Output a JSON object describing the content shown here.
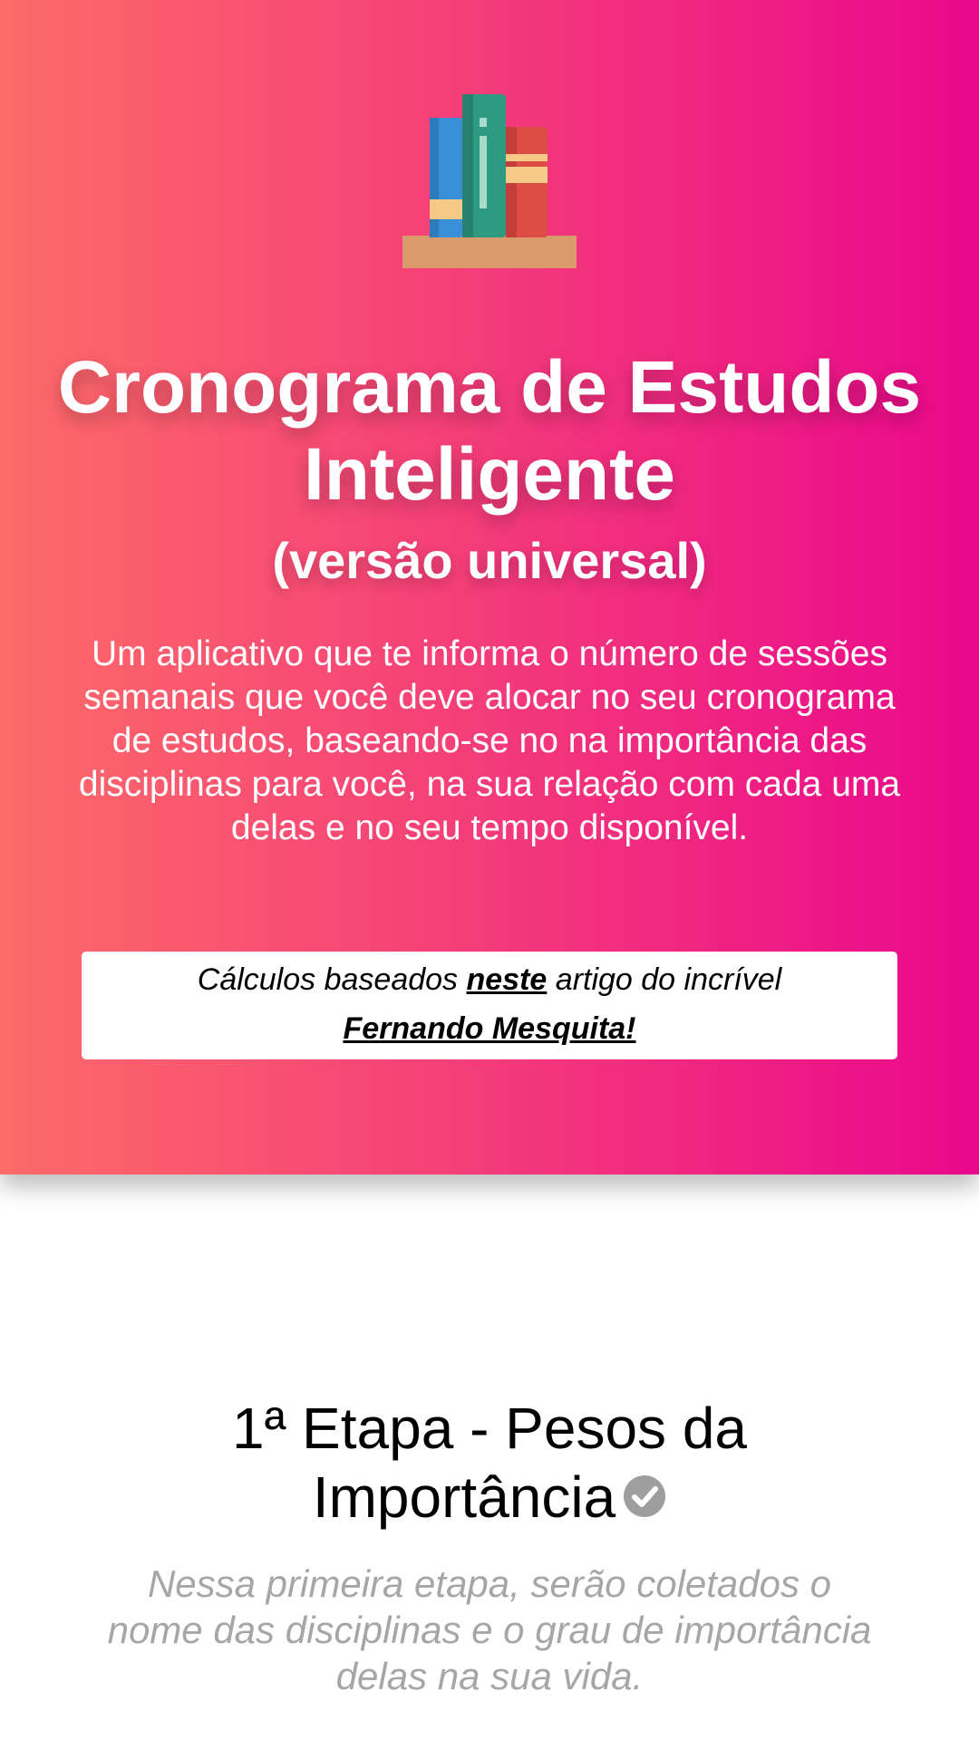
{
  "header": {
    "logo_icon": "bookshelf-icon",
    "title": "Cronograma de Estudos Inteligente",
    "subtitle": "(versão universal)",
    "description": "Um aplicativo que te informa o número de sessões semanais que você deve alocar no seu cronograma de estudos, baseando-se no na importância das disciplinas para você, na sua relação com cada uma delas e no seu tempo disponível.",
    "credit": {
      "prefix": "Cálculos baseados",
      "link_label": "neste",
      "middle": "artigo do incrível",
      "author_label": "Fernando Mesquita!"
    },
    "gradient_colors": [
      "#fd6b68",
      "#f43b7a",
      "#ea078c"
    ]
  },
  "step": {
    "title": "1ª Etapa - Pesos da Importância",
    "status_icon": "check-circle-icon",
    "description": "Nessa primeira etapa, serão coletados o nome das disciplinas e o grau de importância delas na sua vida."
  }
}
